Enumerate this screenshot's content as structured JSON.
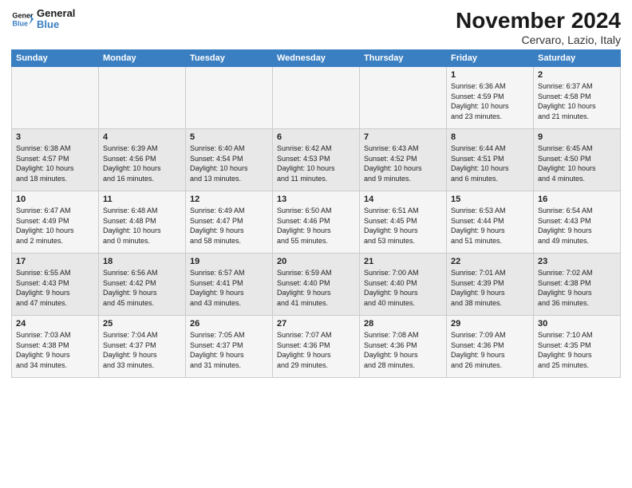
{
  "header": {
    "logo_line1": "General",
    "logo_line2": "Blue",
    "month_title": "November 2024",
    "location": "Cervaro, Lazio, Italy"
  },
  "weekdays": [
    "Sunday",
    "Monday",
    "Tuesday",
    "Wednesday",
    "Thursday",
    "Friday",
    "Saturday"
  ],
  "weeks": [
    [
      {
        "day": "",
        "info": ""
      },
      {
        "day": "",
        "info": ""
      },
      {
        "day": "",
        "info": ""
      },
      {
        "day": "",
        "info": ""
      },
      {
        "day": "",
        "info": ""
      },
      {
        "day": "1",
        "info": "Sunrise: 6:36 AM\nSunset: 4:59 PM\nDaylight: 10 hours\nand 23 minutes."
      },
      {
        "day": "2",
        "info": "Sunrise: 6:37 AM\nSunset: 4:58 PM\nDaylight: 10 hours\nand 21 minutes."
      }
    ],
    [
      {
        "day": "3",
        "info": "Sunrise: 6:38 AM\nSunset: 4:57 PM\nDaylight: 10 hours\nand 18 minutes."
      },
      {
        "day": "4",
        "info": "Sunrise: 6:39 AM\nSunset: 4:56 PM\nDaylight: 10 hours\nand 16 minutes."
      },
      {
        "day": "5",
        "info": "Sunrise: 6:40 AM\nSunset: 4:54 PM\nDaylight: 10 hours\nand 13 minutes."
      },
      {
        "day": "6",
        "info": "Sunrise: 6:42 AM\nSunset: 4:53 PM\nDaylight: 10 hours\nand 11 minutes."
      },
      {
        "day": "7",
        "info": "Sunrise: 6:43 AM\nSunset: 4:52 PM\nDaylight: 10 hours\nand 9 minutes."
      },
      {
        "day": "8",
        "info": "Sunrise: 6:44 AM\nSunset: 4:51 PM\nDaylight: 10 hours\nand 6 minutes."
      },
      {
        "day": "9",
        "info": "Sunrise: 6:45 AM\nSunset: 4:50 PM\nDaylight: 10 hours\nand 4 minutes."
      }
    ],
    [
      {
        "day": "10",
        "info": "Sunrise: 6:47 AM\nSunset: 4:49 PM\nDaylight: 10 hours\nand 2 minutes."
      },
      {
        "day": "11",
        "info": "Sunrise: 6:48 AM\nSunset: 4:48 PM\nDaylight: 10 hours\nand 0 minutes."
      },
      {
        "day": "12",
        "info": "Sunrise: 6:49 AM\nSunset: 4:47 PM\nDaylight: 9 hours\nand 58 minutes."
      },
      {
        "day": "13",
        "info": "Sunrise: 6:50 AM\nSunset: 4:46 PM\nDaylight: 9 hours\nand 55 minutes."
      },
      {
        "day": "14",
        "info": "Sunrise: 6:51 AM\nSunset: 4:45 PM\nDaylight: 9 hours\nand 53 minutes."
      },
      {
        "day": "15",
        "info": "Sunrise: 6:53 AM\nSunset: 4:44 PM\nDaylight: 9 hours\nand 51 minutes."
      },
      {
        "day": "16",
        "info": "Sunrise: 6:54 AM\nSunset: 4:43 PM\nDaylight: 9 hours\nand 49 minutes."
      }
    ],
    [
      {
        "day": "17",
        "info": "Sunrise: 6:55 AM\nSunset: 4:43 PM\nDaylight: 9 hours\nand 47 minutes."
      },
      {
        "day": "18",
        "info": "Sunrise: 6:56 AM\nSunset: 4:42 PM\nDaylight: 9 hours\nand 45 minutes."
      },
      {
        "day": "19",
        "info": "Sunrise: 6:57 AM\nSunset: 4:41 PM\nDaylight: 9 hours\nand 43 minutes."
      },
      {
        "day": "20",
        "info": "Sunrise: 6:59 AM\nSunset: 4:40 PM\nDaylight: 9 hours\nand 41 minutes."
      },
      {
        "day": "21",
        "info": "Sunrise: 7:00 AM\nSunset: 4:40 PM\nDaylight: 9 hours\nand 40 minutes."
      },
      {
        "day": "22",
        "info": "Sunrise: 7:01 AM\nSunset: 4:39 PM\nDaylight: 9 hours\nand 38 minutes."
      },
      {
        "day": "23",
        "info": "Sunrise: 7:02 AM\nSunset: 4:38 PM\nDaylight: 9 hours\nand 36 minutes."
      }
    ],
    [
      {
        "day": "24",
        "info": "Sunrise: 7:03 AM\nSunset: 4:38 PM\nDaylight: 9 hours\nand 34 minutes."
      },
      {
        "day": "25",
        "info": "Sunrise: 7:04 AM\nSunset: 4:37 PM\nDaylight: 9 hours\nand 33 minutes."
      },
      {
        "day": "26",
        "info": "Sunrise: 7:05 AM\nSunset: 4:37 PM\nDaylight: 9 hours\nand 31 minutes."
      },
      {
        "day": "27",
        "info": "Sunrise: 7:07 AM\nSunset: 4:36 PM\nDaylight: 9 hours\nand 29 minutes."
      },
      {
        "day": "28",
        "info": "Sunrise: 7:08 AM\nSunset: 4:36 PM\nDaylight: 9 hours\nand 28 minutes."
      },
      {
        "day": "29",
        "info": "Sunrise: 7:09 AM\nSunset: 4:36 PM\nDaylight: 9 hours\nand 26 minutes."
      },
      {
        "day": "30",
        "info": "Sunrise: 7:10 AM\nSunset: 4:35 PM\nDaylight: 9 hours\nand 25 minutes."
      }
    ]
  ]
}
